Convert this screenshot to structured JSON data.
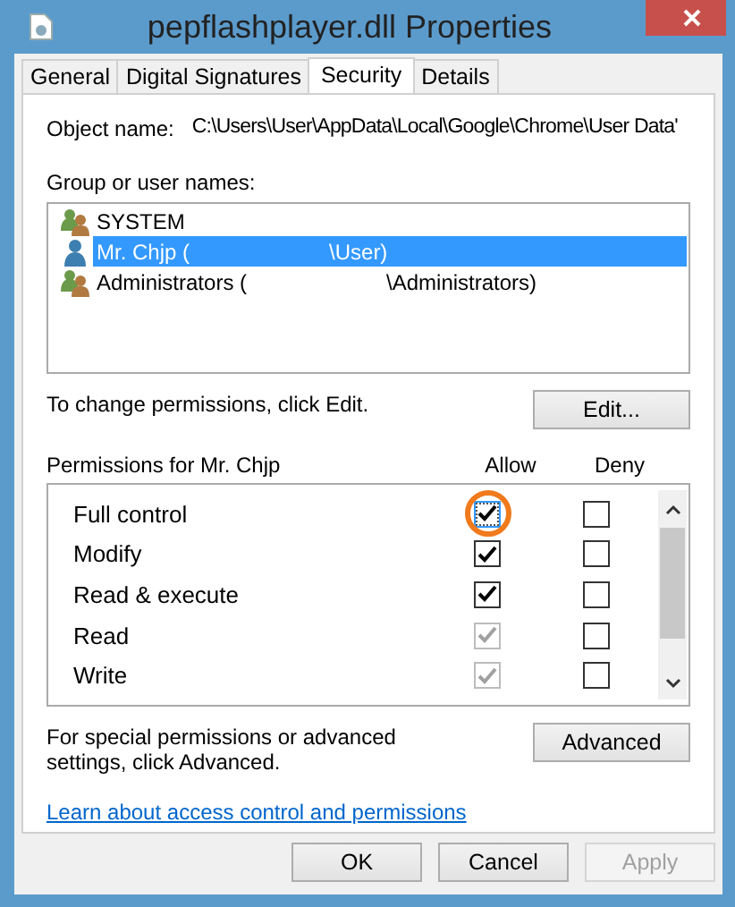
{
  "window": {
    "title": "pepflashplayer.dll Properties"
  },
  "tabs": [
    {
      "label": "General",
      "selected": false
    },
    {
      "label": "Digital Signatures",
      "selected": false
    },
    {
      "label": "Security",
      "selected": true
    },
    {
      "label": "Details",
      "selected": false
    }
  ],
  "object_name": {
    "label": "Object name:",
    "value": "C:\\Users\\User\\AppData\\Local\\Google\\Chrome\\User Data'"
  },
  "groups": {
    "label": "Group or user names:",
    "items": [
      {
        "kind": "group",
        "label": "SYSTEM",
        "selected": false
      },
      {
        "kind": "user",
        "label": "Mr. Chjp (",
        "label_end": "\\User)",
        "selected": true
      },
      {
        "kind": "group",
        "label": "Administrators (",
        "label_end": "\\Administrators)",
        "selected": false
      }
    ]
  },
  "edit_hint": "To change permissions, click Edit.",
  "edit_button": "Edit...",
  "permissions": {
    "label": "Permissions for Mr. Chjp",
    "columns": [
      "Allow",
      "Deny"
    ],
    "rows": [
      {
        "name": "Full control",
        "allow": {
          "checked": true,
          "disabled": false,
          "focused": true
        },
        "deny": {
          "checked": false,
          "disabled": false
        }
      },
      {
        "name": "Modify",
        "allow": {
          "checked": true,
          "disabled": false
        },
        "deny": {
          "checked": false,
          "disabled": false
        }
      },
      {
        "name": "Read & execute",
        "allow": {
          "checked": true,
          "disabled": false
        },
        "deny": {
          "checked": false,
          "disabled": false
        }
      },
      {
        "name": "Read",
        "allow": {
          "checked": true,
          "disabled": true
        },
        "deny": {
          "checked": false,
          "disabled": false
        }
      },
      {
        "name": "Write",
        "allow": {
          "checked": true,
          "disabled": true
        },
        "deny": {
          "checked": false,
          "disabled": false
        }
      }
    ]
  },
  "advanced_hint": "For special permissions or advanced settings, click Advanced.",
  "advanced_button": "Advanced",
  "link": "Learn about access control and permissions",
  "buttons": [
    {
      "label": "OK",
      "disabled": false
    },
    {
      "label": "Cancel",
      "disabled": false
    },
    {
      "label": "Apply",
      "disabled": true
    }
  ]
}
